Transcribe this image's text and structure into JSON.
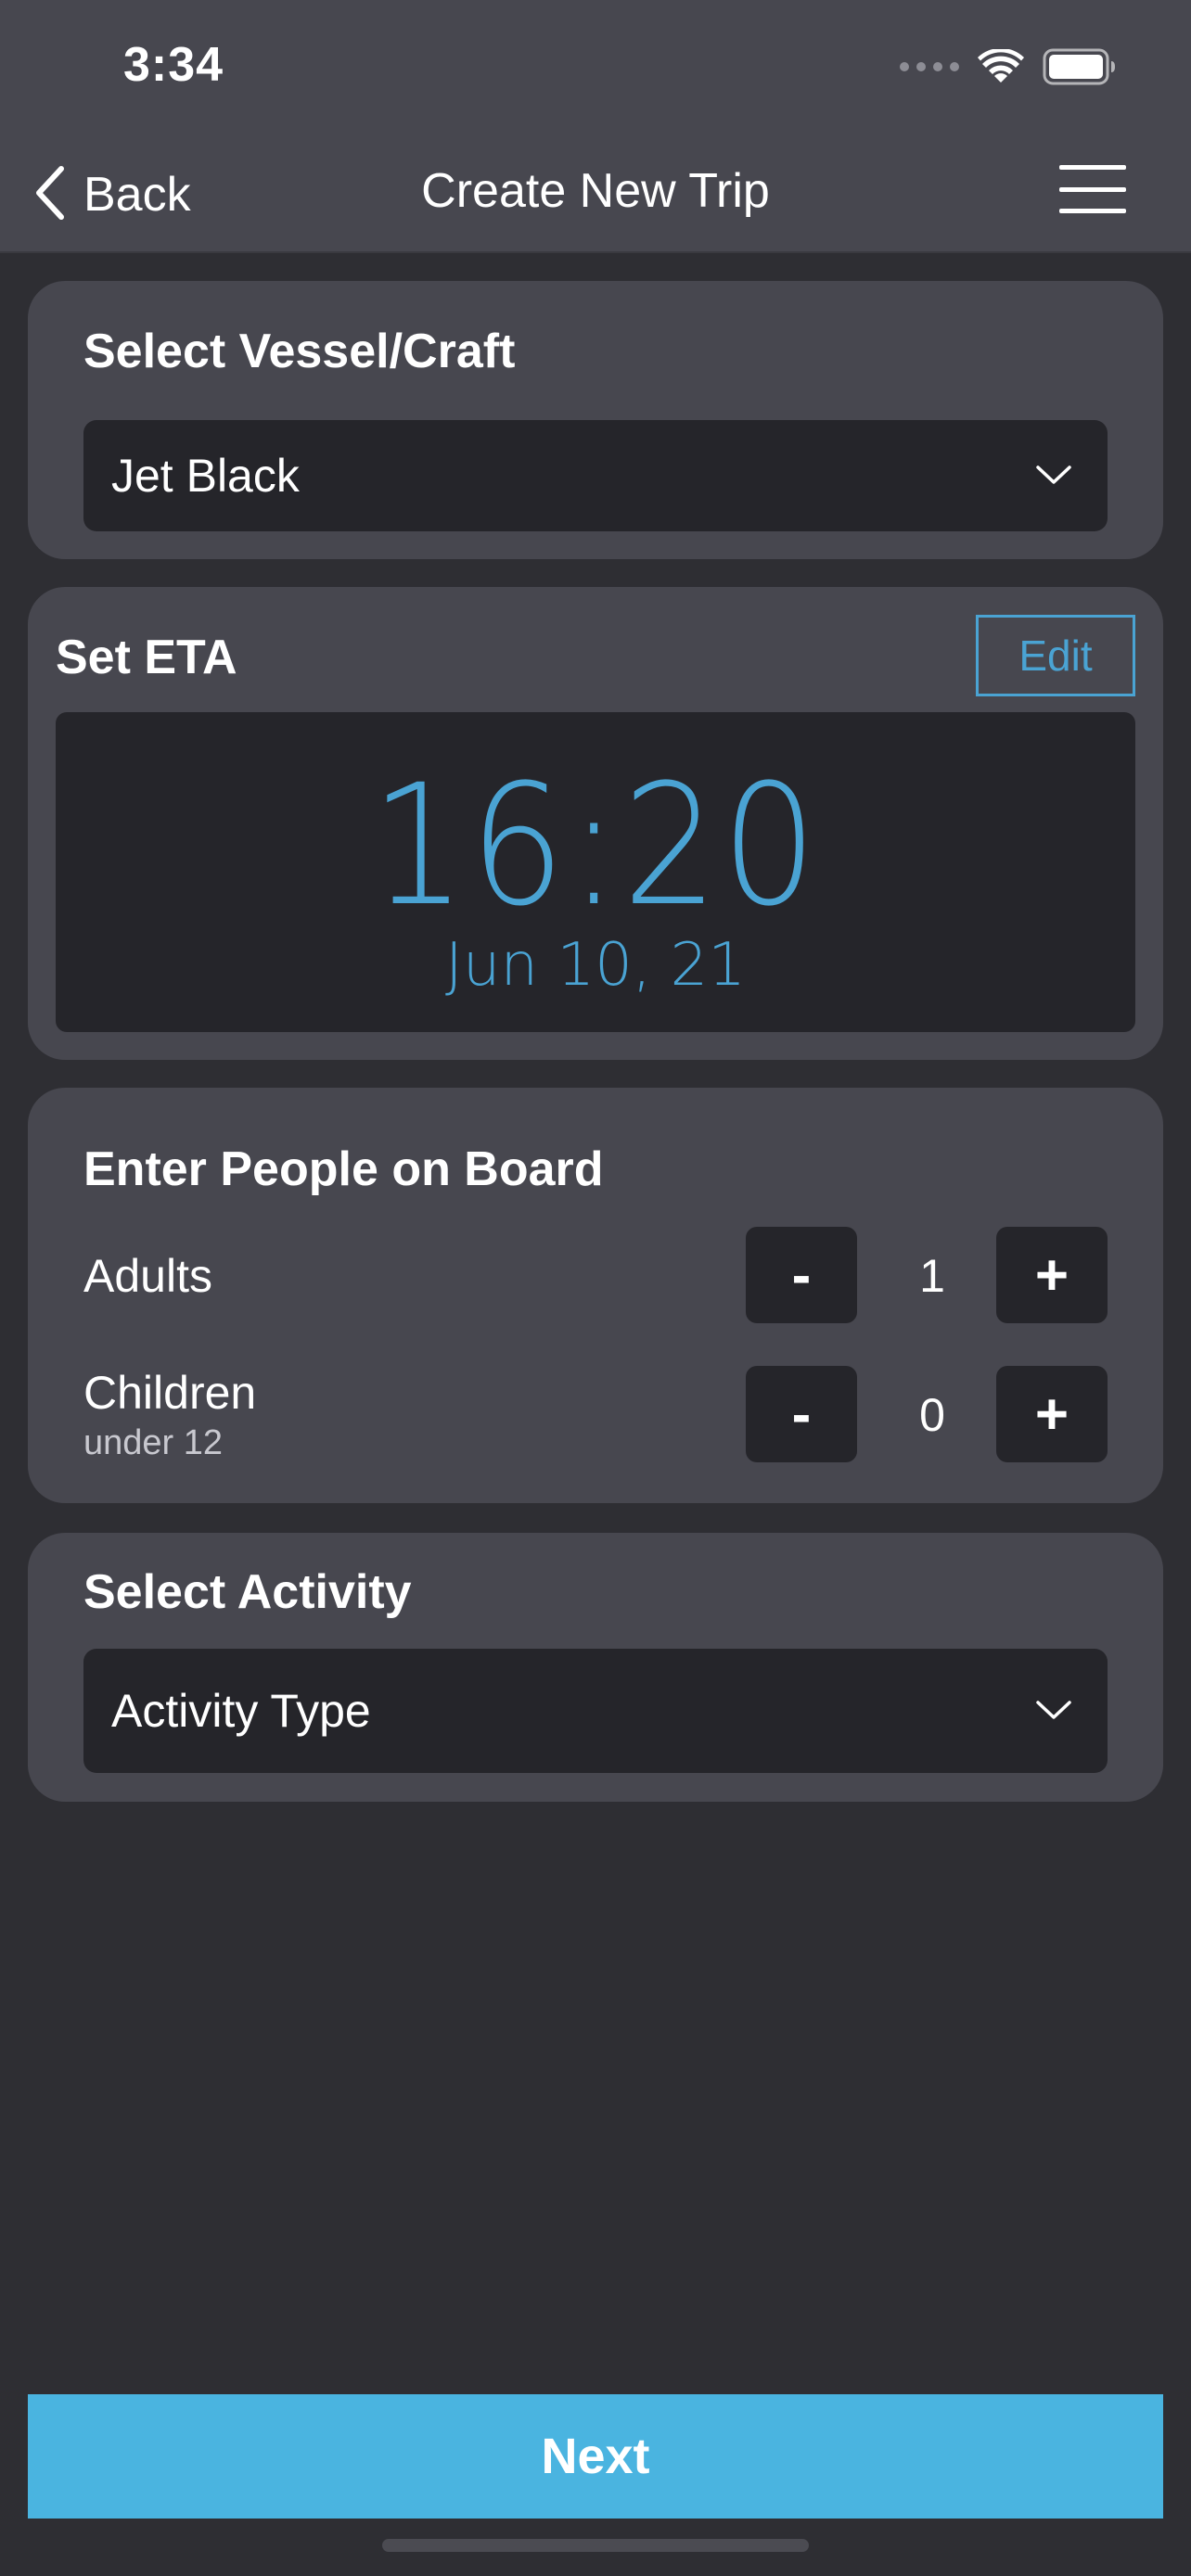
{
  "status_bar": {
    "time": "3:34"
  },
  "nav": {
    "back_label": "Back",
    "title": "Create New Trip"
  },
  "vessel": {
    "title": "Select Vessel/Craft",
    "selected": "Jet Black"
  },
  "eta": {
    "title": "Set ETA",
    "edit_label": "Edit",
    "time": "16:20",
    "date": "Jun 10, 21"
  },
  "people": {
    "title": "Enter People on Board",
    "adults": {
      "label": "Adults",
      "value": "1"
    },
    "children": {
      "label": "Children",
      "sublabel": "under 12",
      "value": "0"
    },
    "minus_label": "-",
    "plus_label": "+"
  },
  "activity": {
    "title": "Select Activity",
    "placeholder": "Activity Type"
  },
  "footer": {
    "next_label": "Next"
  },
  "colors": {
    "accent": "#4ab4e0",
    "eta_text": "#4aa3d3",
    "card": "#47474f",
    "field": "#25252a",
    "background": "#2e2e33"
  },
  "icons": [
    "cellular-dots-icon",
    "wifi-icon",
    "battery-icon",
    "chevron-left-icon",
    "hamburger-menu-icon",
    "chevron-down-icon"
  ]
}
